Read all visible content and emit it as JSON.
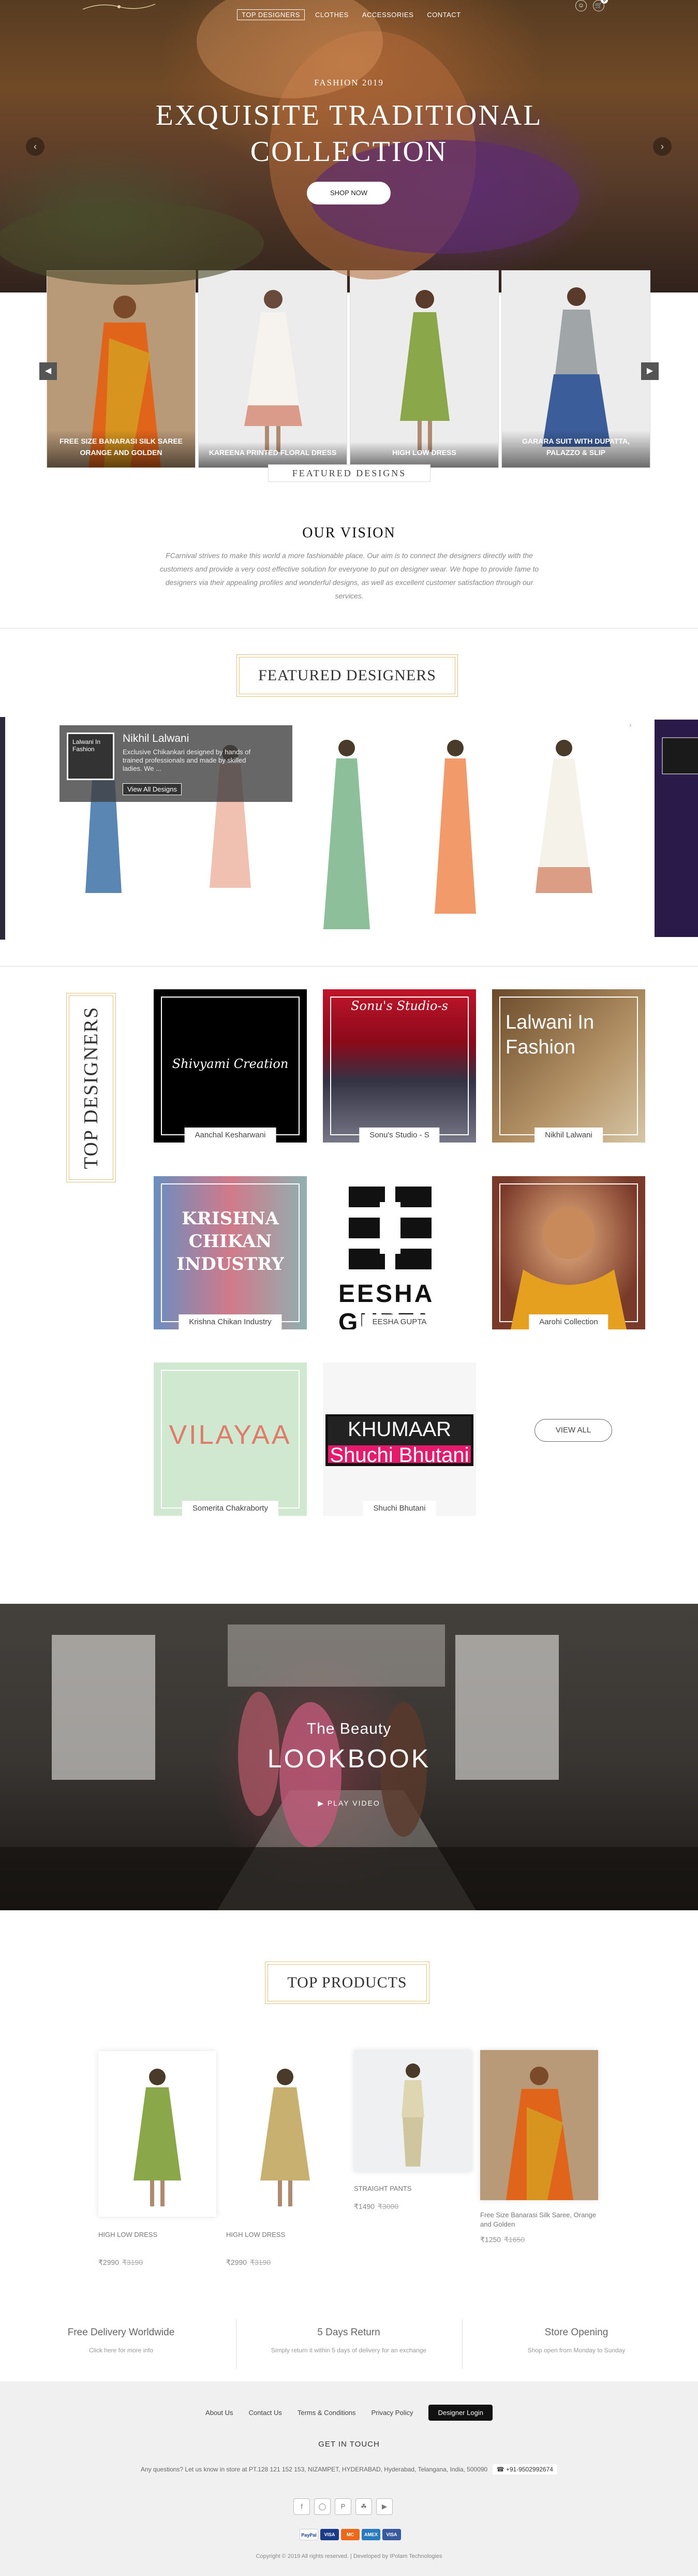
{
  "nav": {
    "items": [
      "TOP DESIGNERS",
      "CLOTHES",
      "ACCESSORIES",
      "CONTACT"
    ],
    "icons": [
      "user-icon",
      "cart-icon"
    ],
    "cart_count": "0"
  },
  "hero": {
    "subtitle": "FASHION 2019",
    "title_line1": "EXQUISITE TRADITIONAL",
    "title_line2": "COLLECTION",
    "button": "SHOP NOW"
  },
  "categories": [
    {
      "label": "FREE SIZE BANARASI SILK SAREE ORANGE AND GOLDEN"
    },
    {
      "label": "KAREENA PRINTED FLORAL DRESS"
    },
    {
      "label": "HIGH LOW DRESS"
    },
    {
      "label": "GARARA SUIT WITH DUPATTA, PALAZZO & SLIP"
    }
  ],
  "featured_tag": "FEATURED DESIGNS",
  "vision": {
    "title": "OUR VISION",
    "text": "FCarnival strives to make this world a more fashionable place. Our aim is to connect the designers directly with the customers and provide a very cost effective solution for everyone to put on designer wear. We hope to provide fame to designers via their appealing profiles and wonderful designs, as well as excellent customer satisfaction through our services."
  },
  "featured": {
    "title": "FEATURED DESIGNERS",
    "designer_name": "Nikhil Lalwani",
    "designer_desc": "Exclusive Chikankari designed by hands of trained professionals and made by skilled ladies. We ...",
    "designer_button": "View All Designs",
    "thumb_text": "Lalwani In Fashion"
  },
  "top_designers": {
    "title": "TOP DESIGNERS",
    "tiles": [
      {
        "name": "Aanchal Kesharwani",
        "logo_text": "Shivyami Creation"
      },
      {
        "name": "Sonu's Studio - S",
        "logo_text": "Sonu's Studio-s"
      },
      {
        "name": "Nikhil Lalwani",
        "logo_text": "Lalwani In Fashion"
      },
      {
        "name": "Krishna Chikan Industry",
        "logo_text": "KRISHNA CHIKAN INDUSTRY"
      },
      {
        "name": "EESHA GUPTA",
        "logo_text": "EESHA GUPTA"
      },
      {
        "name": "Aarohi Collection",
        "logo_text": ""
      },
      {
        "name": "Somerita Chakraborty",
        "logo_text": "VILAYAA"
      },
      {
        "name": "Shuchi Bhutani",
        "logo_text": "KHUMAAR Shuchi Bhutani"
      }
    ],
    "view_all": "VIEW ALL"
  },
  "lookbook": {
    "subtitle": "The Beauty",
    "title": "LOOKBOOK",
    "play": "▶ PLAY VIDEO"
  },
  "products": {
    "title": "TOP PRODUCTS",
    "items": [
      {
        "name": "HIGH LOW DRESS",
        "price": "₹2990",
        "old": "₹3190"
      },
      {
        "name": "HIGH LOW DRESS",
        "price": "₹2990",
        "old": "₹3190"
      },
      {
        "name": "STRAIGHT PANTS",
        "price": "₹1490",
        "old": "₹3000"
      },
      {
        "name": "Free Size Banarasi Silk Saree, Orange and Golden",
        "price": "₹1250",
        "old": "₹1650"
      }
    ]
  },
  "features": [
    {
      "title": "Free Delivery Worldwide",
      "desc": "Click here for more info"
    },
    {
      "title": "5 Days Return",
      "desc": "Simply return it within 5 days of delivery for an exchange"
    },
    {
      "title": "Store Opening",
      "desc": "Shop open from Monday to Sunday"
    }
  ],
  "footer": {
    "links": [
      "About Us",
      "Contact Us",
      "Terms & Conditions",
      "Privacy Policy"
    ],
    "login": "Designer Login",
    "get_in_touch": "GET IN TOUCH",
    "address": "Any questions? Let us know in store at PT.128 121 152 153, NIZAMPET, HYDERABAD, Hyderabad, Telangana, India, 500090",
    "phone": "+91-9502992674",
    "social_icons": [
      "facebook-icon",
      "instagram-icon",
      "pinterest-icon",
      "snapchat-icon",
      "youtube-icon"
    ],
    "cards": [
      "PayPal",
      "VISA",
      "MC",
      "AMEX",
      "VISA"
    ],
    "copyright": "Copyright © 2019 All rights reserved. | Developed by IPolam Technologies"
  }
}
